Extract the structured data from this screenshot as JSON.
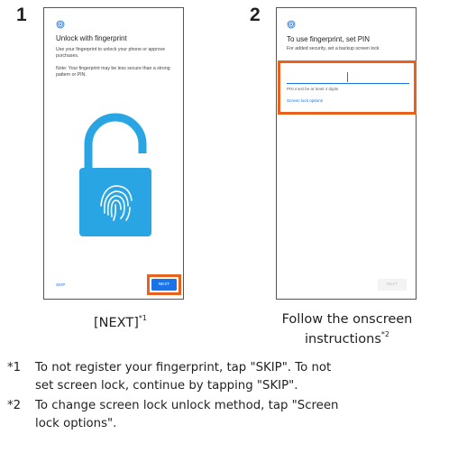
{
  "steps": [
    {
      "number": "1",
      "screen": {
        "title": "Unlock with fingerprint",
        "body": "Use your fingerprint to unlock your phone or approve purchases.",
        "note": "Note: Your fingerprint may be less secure than a strong pattern or PIN.",
        "skip_label": "SKIP",
        "next_label": "NEXT"
      },
      "caption": "[NEXT]",
      "caption_ref": "*1"
    },
    {
      "number": "2",
      "screen": {
        "title": "To use fingerprint, set PIN",
        "subtitle": "For added security, set a backup screen lock",
        "pin_value": "",
        "pin_hint": "PIN must be at least 4 digits",
        "options_link": "Screen lock options",
        "next_label": "NEXT"
      },
      "caption_line1": "Follow the onscreen",
      "caption_line2": "instructions",
      "caption_ref": "*2"
    }
  ],
  "notes": [
    {
      "mark": "*1",
      "line1": "To not register your fingerprint, tap \"SKIP\". To not",
      "line2": "set screen lock, continue by tapping \"SKIP\"."
    },
    {
      "mark": "*2",
      "line1": "To change screen lock unlock method, tap \"Screen",
      "line2": "lock options\"."
    }
  ],
  "colors": {
    "highlight": "#e8621e",
    "lock_blue": "#29a5e3",
    "link_blue": "#1a73e8",
    "next_button": "#1a73e8"
  }
}
